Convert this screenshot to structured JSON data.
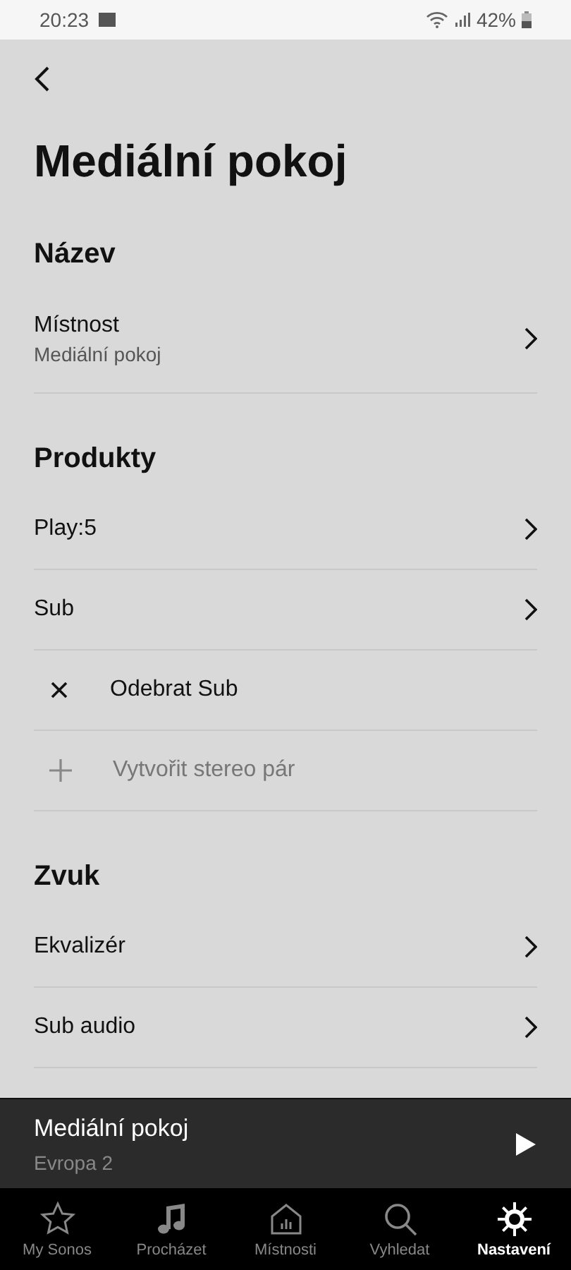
{
  "status_bar": {
    "time": "20:23",
    "battery": "42%"
  },
  "title": "Mediální pokoj",
  "sections": [
    {
      "heading": "Název",
      "items": [
        {
          "kind": "link",
          "label": "Místnost",
          "subtitle": "Mediální pokoj"
        }
      ]
    },
    {
      "heading": "Produkty",
      "items": [
        {
          "kind": "link",
          "label": "Play:5"
        },
        {
          "kind": "link",
          "label": "Sub"
        },
        {
          "kind": "remove",
          "label": "Odebrat Sub",
          "disabled": false
        },
        {
          "kind": "add",
          "label": "Vytvořit stereo pár",
          "disabled": true
        }
      ]
    },
    {
      "heading": "Zvuk",
      "items": [
        {
          "kind": "link",
          "label": "Ekvalizér"
        },
        {
          "kind": "link",
          "label": "Sub audio"
        }
      ]
    }
  ],
  "now_playing": {
    "room": "Mediální pokoj",
    "station": "Evropa 2"
  },
  "tabs": [
    {
      "kind": "star",
      "label": "My Sonos",
      "selected": false
    },
    {
      "kind": "music",
      "label": "Procházet",
      "selected": false
    },
    {
      "kind": "rooms",
      "label": "Místnosti",
      "selected": false
    },
    {
      "kind": "search",
      "label": "Vyhledat",
      "selected": false
    },
    {
      "kind": "settings",
      "label": "Nastavení",
      "selected": true
    }
  ]
}
